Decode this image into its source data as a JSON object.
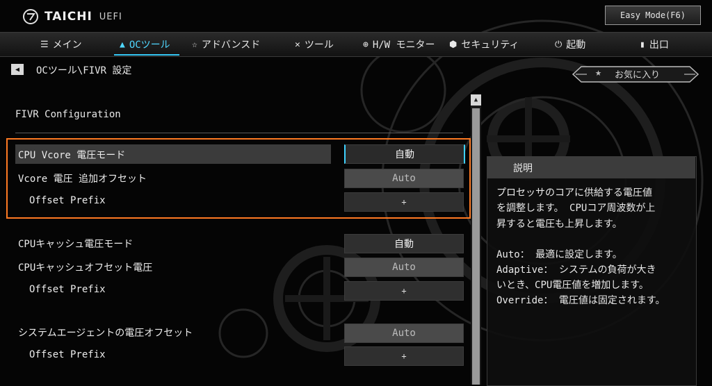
{
  "header": {
    "brand": "TAICHI",
    "brand_sub": "UEFI",
    "easy_mode_button": "Easy Mode(F6)"
  },
  "nav": {
    "items": [
      {
        "label": "メイン",
        "icon": "list-icon"
      },
      {
        "label": "OCツール",
        "icon": "rocket-icon",
        "active": true
      },
      {
        "label": "アドバンスド",
        "icon": "star-icon"
      },
      {
        "label": "ツール",
        "icon": "tools-icon"
      },
      {
        "label": "H/W モニター",
        "icon": "crosshair-icon"
      },
      {
        "label": "セキュリティ",
        "icon": "shield-icon"
      },
      {
        "label": "起動",
        "icon": "power-icon"
      },
      {
        "label": "出口",
        "icon": "exit-icon"
      }
    ]
  },
  "breadcrumb": "OCツール\\FIVR 設定",
  "favorites": {
    "label": "お気に入り"
  },
  "section_title": "FIVR Configuration",
  "settings": [
    {
      "label": "CPU Vcore 電圧モード",
      "value": "自動"
    },
    {
      "label": "Vcore 電圧 追加オフセット",
      "value": "Auto"
    },
    {
      "label": "Offset Prefix",
      "value": "+"
    },
    {
      "label": "CPUキャッシュ電圧モード",
      "value": "自動"
    },
    {
      "label": "CPUキャッシュオフセット電圧",
      "value": "Auto"
    },
    {
      "label": "Offset Prefix",
      "value": "+"
    },
    {
      "label": "システムエージェントの電圧オフセット",
      "value": "Auto"
    },
    {
      "label": "Offset Prefix",
      "value": "+"
    }
  ],
  "description": {
    "title": "説明",
    "lines": [
      "プロセッサのコアに供給する電圧値",
      "を調整します。 CPUコア周波数が上",
      "昇すると電圧も上昇します。",
      "",
      "Auto： 最適に設定します。",
      "Adaptive： システムの負荷が大き",
      "いとき、CPU電圧値を増加します。",
      "Override： 電圧値は固定されます。"
    ]
  },
  "colors": {
    "accent": "#35c8f5",
    "highlight_box": "#ff7a22"
  }
}
